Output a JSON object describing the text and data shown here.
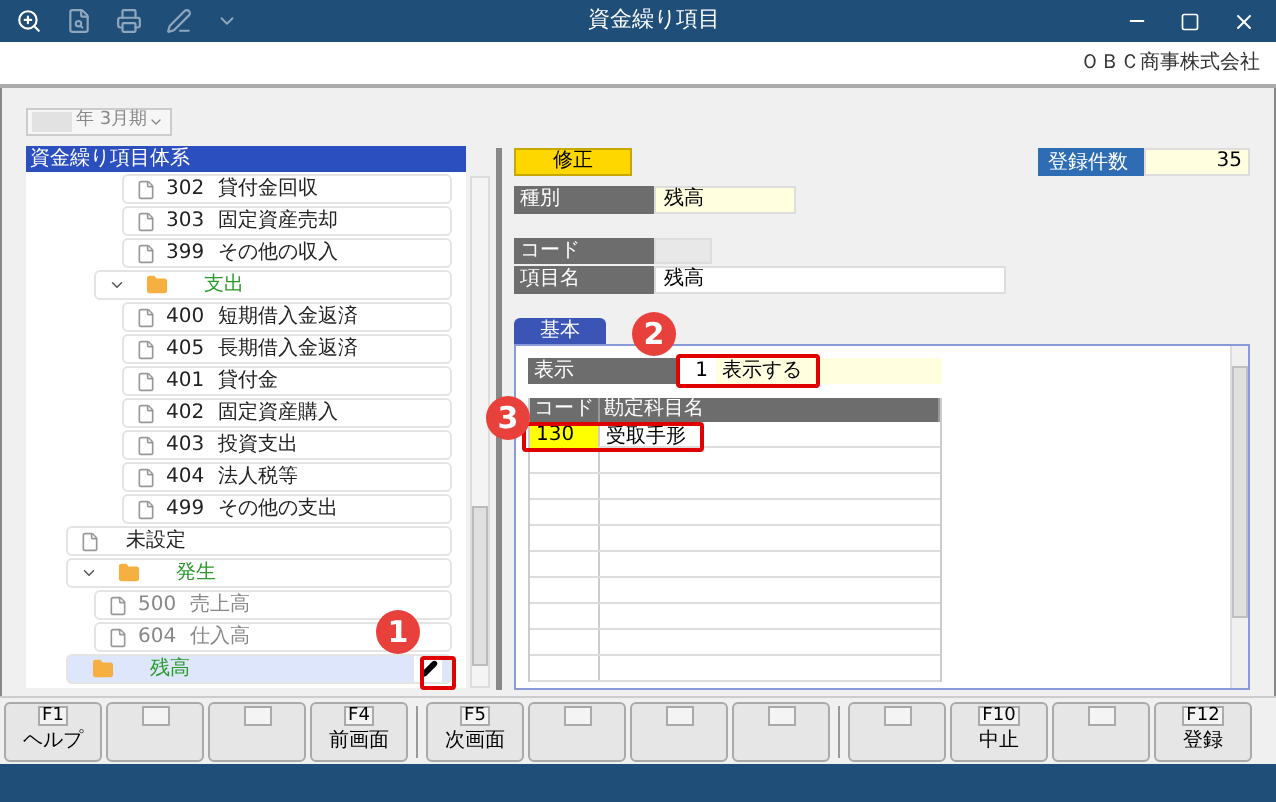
{
  "window": {
    "title": "資金繰り項目"
  },
  "company": "ＯＢＣ商事株式会社",
  "period": {
    "value": "年 3月期"
  },
  "tree": {
    "title": "資金繰り項目体系",
    "items": [
      {
        "children": [
          {
            "children": [
              {
                "kind": "item",
                "code": "302",
                "label": "貸付金回収",
                "selected": false,
                "disabled": false
              },
              {
                "kind": "item",
                "code": "303",
                "label": "固定資産売却",
                "selected": false,
                "disabled": false
              },
              {
                "kind": "item",
                "code": "399",
                "label": "その他の収入",
                "selected": false,
                "disabled": false
              }
            ]
          },
          {
            "kind": "folder",
            "label": "支出",
            "expanded": true,
            "selected": false,
            "children": [
              {
                "kind": "item",
                "code": "400",
                "label": "短期借入金返済",
                "selected": false,
                "disabled": false
              },
              {
                "kind": "item",
                "code": "405",
                "label": "長期借入金返済",
                "selected": false,
                "disabled": false
              },
              {
                "kind": "item",
                "code": "401",
                "label": "貸付金",
                "selected": false,
                "disabled": false
              },
              {
                "kind": "item",
                "code": "402",
                "label": "固定資産購入",
                "selected": false,
                "disabled": false
              },
              {
                "kind": "item",
                "code": "403",
                "label": "投資支出",
                "selected": false,
                "disabled": false
              },
              {
                "kind": "item",
                "code": "404",
                "label": "法人税等",
                "selected": false,
                "disabled": false
              },
              {
                "kind": "item",
                "code": "499",
                "label": "その他の支出",
                "selected": false,
                "disabled": false
              }
            ]
          }
        ]
      },
      {
        "kind": "item",
        "label": "未設定",
        "selected": false,
        "disabled": false
      },
      {
        "kind": "folder",
        "label": "発生",
        "expanded": true,
        "selected": false,
        "children": [
          {
            "kind": "item",
            "code": "500",
            "label": "売上高",
            "selected": false,
            "disabled": true
          },
          {
            "kind": "item",
            "code": "604",
            "label": "仕入高",
            "selected": false,
            "disabled": true
          }
        ]
      },
      {
        "kind": "folder",
        "label": "残高",
        "selected": true
      }
    ]
  },
  "mode_button": "修正",
  "record_count": {
    "label": "登録件数",
    "value": "35"
  },
  "fields": {
    "type": {
      "label": "種別",
      "value": "残高"
    },
    "code": {
      "label": "コード"
    },
    "name": {
      "label": "項目名",
      "value": "残高"
    }
  },
  "tabs": [
    {
      "label": "基本",
      "selected": true
    }
  ],
  "display": {
    "label": "表示",
    "code": "1",
    "value": "表示する"
  },
  "grid": {
    "columns": [
      "コード",
      "勘定科目名"
    ],
    "rows": [
      {
        "cells": [
          "130",
          "受取手形"
        ],
        "selected": true
      }
    ]
  },
  "annotations": [
    {
      "number": "1"
    },
    {
      "number": "2"
    },
    {
      "number": "3"
    }
  ],
  "function_keys": [
    {
      "kind": "key",
      "key": "F1",
      "label": "ヘルプ"
    },
    {
      "kind": "blank"
    },
    {
      "kind": "blank"
    },
    {
      "kind": "key",
      "key": "F4",
      "label": "前画面"
    },
    {
      "kind": "key",
      "key": "F5",
      "label": "次画面"
    },
    {
      "kind": "blank"
    },
    {
      "kind": "blank"
    },
    {
      "kind": "blank"
    },
    {
      "kind": "blank"
    },
    {
      "kind": "key",
      "key": "F10",
      "label": "中止"
    },
    {
      "kind": "blank"
    },
    {
      "kind": "key",
      "key": "F12",
      "label": "登録"
    }
  ]
}
